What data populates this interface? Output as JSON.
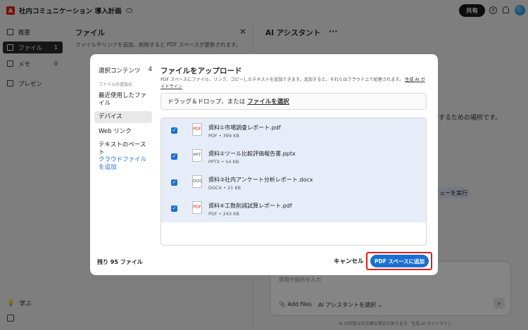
{
  "header": {
    "doc_title": "社内コミュニケーション 導入計画",
    "share_label": "共有"
  },
  "sidebar": {
    "items": [
      {
        "label": "概要",
        "count": ""
      },
      {
        "label": "ファイル",
        "count": "1"
      },
      {
        "label": "メモ",
        "count": "0"
      },
      {
        "label": "プレゼン",
        "count": ""
      }
    ],
    "learn_label": "学ぶ"
  },
  "files_panel": {
    "title": "ファイル",
    "description": "ファイルやリンクを追加、削除すると PDF スペースが更新されます。"
  },
  "ai_panel": {
    "title": "AI アシスタント",
    "place_text": "するための場所です。",
    "run_text": "ューを実行",
    "input_placeholder": "質問や指示を入力",
    "add_files_label": "Add files",
    "assistant_select_label": "AI アシスタントを選択",
    "footer_note": "AI の回答は不正確な場合があります。生成 AI ガイドライン"
  },
  "modal": {
    "nav_title": "選択コンテンツ",
    "nav_count": "4",
    "nav_subtitle": "ファイルの追加元",
    "nav_items": [
      {
        "label": "最近使用したファイル"
      },
      {
        "label": "デバイス"
      },
      {
        "label": "Web リンク"
      },
      {
        "label": "テキストのペースト"
      },
      {
        "label": "クラウドファイルを追加"
      }
    ],
    "title": "ファイルをアップロード",
    "description": "PDF スペースにファイル、リンク、コピーしたテキストを追加できます。追加すると、それらはクラウド上で処理されます。",
    "guideline_link": "生成 AI ガイドライン",
    "dropzone_text": "ドラッグ＆ドロップ、または",
    "dropzone_link": "ファイルを選択",
    "files": [
      {
        "name": "資料①市場調査レポート.pdf",
        "meta": "PDF • 399 KB",
        "type_icon": "PDF"
      },
      {
        "name": "資料②ツール比較評価報告書.pptx",
        "meta": "PPTX • 54 KB",
        "type_icon": "PPT"
      },
      {
        "name": "資料③社内アンケート分析レポート.docx",
        "meta": "DOCX • 21 KB",
        "type_icon": "DOC"
      },
      {
        "name": "資料④工数削減試算レポート.pdf",
        "meta": "PDF • 243 KB",
        "type_icon": "PDF"
      }
    ],
    "remaining_label": "残り 95 ファイル",
    "cancel_label": "キャンセル",
    "add_label": "PDF スペースに追加"
  },
  "colors": {
    "accent": "#1a6fd1",
    "highlight": "#e0201b",
    "overlay": "rgba(0,0,0,0.48)"
  }
}
